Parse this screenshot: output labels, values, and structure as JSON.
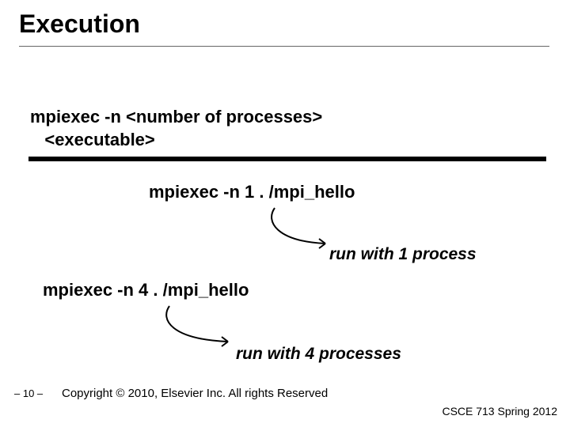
{
  "title": "Execution",
  "syntax_line1": "mpiexec  -n  <number of processes>",
  "syntax_line2": "<executable>",
  "cmd1": "mpiexec  -n  1  . /mpi_hello",
  "caption1": "run with 1 process",
  "cmd2": "mpiexec  -n  4  . /mpi_hello",
  "caption2": "run with 4 processes",
  "page_num": "– 10 –",
  "copyright": "Copyright © 2010, Elsevier Inc. All rights Reserved",
  "course": "CSCE 713 Spring 2012"
}
